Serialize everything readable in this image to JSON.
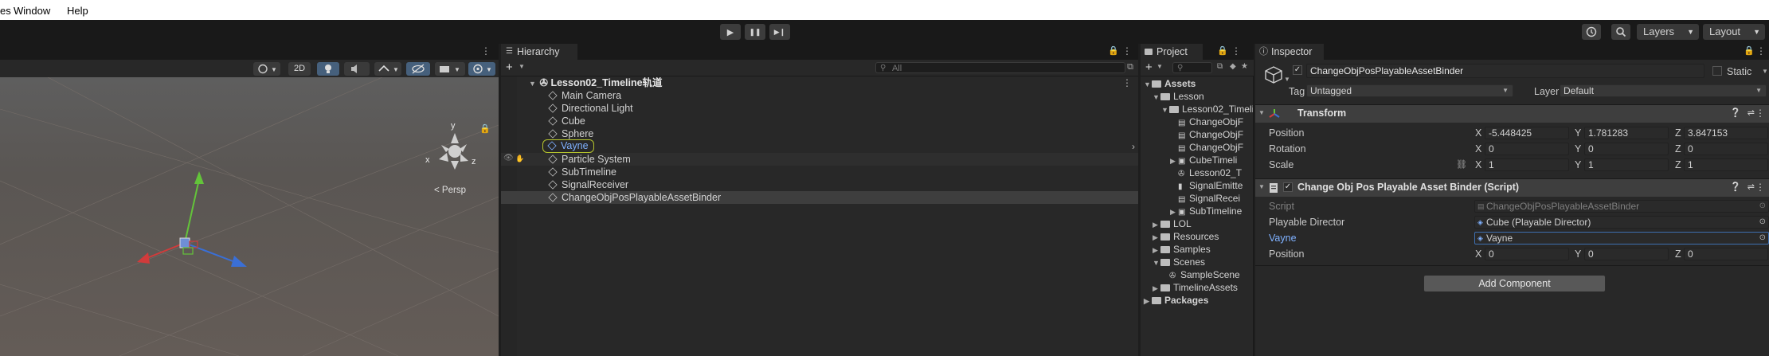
{
  "menu": [
    "es",
    "Window",
    "Help"
  ],
  "toolbar": {
    "play": "▶",
    "pause": "❚❚",
    "step": "▶❙",
    "layers": "Layers",
    "layout": "Layout"
  },
  "scene": {
    "btn_2d": "2D",
    "persp": "Persp",
    "gizmo_y": "y",
    "gizmo_x": "x",
    "gizmo_z": "z"
  },
  "hierarchy": {
    "tab": "Hierarchy",
    "add": "+",
    "search_placeholder": "All",
    "scene_name": "Lesson02_Timeline轨道",
    "items": [
      {
        "label": "Main Camera",
        "selected": false
      },
      {
        "label": "Directional Light",
        "selected": false
      },
      {
        "label": "Cube",
        "selected": false
      },
      {
        "label": "Sphere",
        "selected": false
      },
      {
        "label": "Vayne",
        "selected": false
      },
      {
        "label": "Particle System",
        "selected": false
      },
      {
        "label": "SubTimeline",
        "selected": false
      },
      {
        "label": "SignalReceiver",
        "selected": false
      },
      {
        "label": "ChangeObjPosPlayableAssetBinder",
        "selected": true
      }
    ]
  },
  "project": {
    "tab": "Project",
    "add": "+",
    "tree": [
      {
        "label": "Assets",
        "indent": 0,
        "arrow": "▼",
        "kind": "folder"
      },
      {
        "label": "Lesson",
        "indent": 1,
        "arrow": "▼",
        "kind": "folder"
      },
      {
        "label": "Lesson02_Timeli",
        "indent": 2,
        "arrow": "▼",
        "kind": "folder"
      },
      {
        "label": "ChangeObjF",
        "indent": 3,
        "arrow": "",
        "kind": "script"
      },
      {
        "label": "ChangeObjF",
        "indent": 3,
        "arrow": "",
        "kind": "script"
      },
      {
        "label": "ChangeObjF",
        "indent": 3,
        "arrow": "",
        "kind": "script"
      },
      {
        "label": "CubeTimeli",
        "indent": 3,
        "arrow": "▶",
        "kind": "timeline"
      },
      {
        "label": "Lesson02_T",
        "indent": 3,
        "arrow": "",
        "kind": "unity"
      },
      {
        "label": "SignalEmitte",
        "indent": 3,
        "arrow": "",
        "kind": "signal"
      },
      {
        "label": "SignalRecei",
        "indent": 3,
        "arrow": "",
        "kind": "script"
      },
      {
        "label": "SubTimeline",
        "indent": 3,
        "arrow": "▶",
        "kind": "timeline"
      },
      {
        "label": "LOL",
        "indent": 1,
        "arrow": "▶",
        "kind": "folder"
      },
      {
        "label": "Resources",
        "indent": 1,
        "arrow": "▶",
        "kind": "folder"
      },
      {
        "label": "Samples",
        "indent": 1,
        "arrow": "▶",
        "kind": "folder"
      },
      {
        "label": "Scenes",
        "indent": 1,
        "arrow": "▼",
        "kind": "folder"
      },
      {
        "label": "SampleScene",
        "indent": 2,
        "arrow": "",
        "kind": "unity"
      },
      {
        "label": "TimelineAssets",
        "indent": 1,
        "arrow": "▶",
        "kind": "folder"
      },
      {
        "label": "Packages",
        "indent": 0,
        "arrow": "▶",
        "kind": "folder"
      }
    ]
  },
  "inspector": {
    "tab": "Inspector",
    "object_name": "ChangeObjPosPlayableAssetBinder",
    "static_label": "Static",
    "tag_label": "Tag",
    "tag_value": "Untagged",
    "layer_label": "Layer",
    "layer_value": "Default",
    "transform": {
      "title": "Transform",
      "position_label": "Position",
      "rotation_label": "Rotation",
      "scale_label": "Scale",
      "position": {
        "x": "-5.448425",
        "y": "1.781283",
        "z": "3.847153"
      },
      "rotation": {
        "x": "0",
        "y": "0",
        "z": "0"
      },
      "scale": {
        "x": "1",
        "y": "1",
        "z": "1"
      }
    },
    "script_component": {
      "title": "Change Obj Pos Playable Asset Binder (Script)",
      "script_label": "Script",
      "script_value": "ChangeObjPosPlayableAssetBinder",
      "director_label": "Playable Director",
      "director_value": "Cube (Playable Director)",
      "vayne_label": "Vayne",
      "vayne_value": "Vayne",
      "position_label": "Position",
      "position": {
        "x": "0",
        "y": "0",
        "z": "0"
      }
    },
    "add_component": "Add Component",
    "axis_x": "X",
    "axis_y": "Y",
    "axis_z": "Z"
  }
}
